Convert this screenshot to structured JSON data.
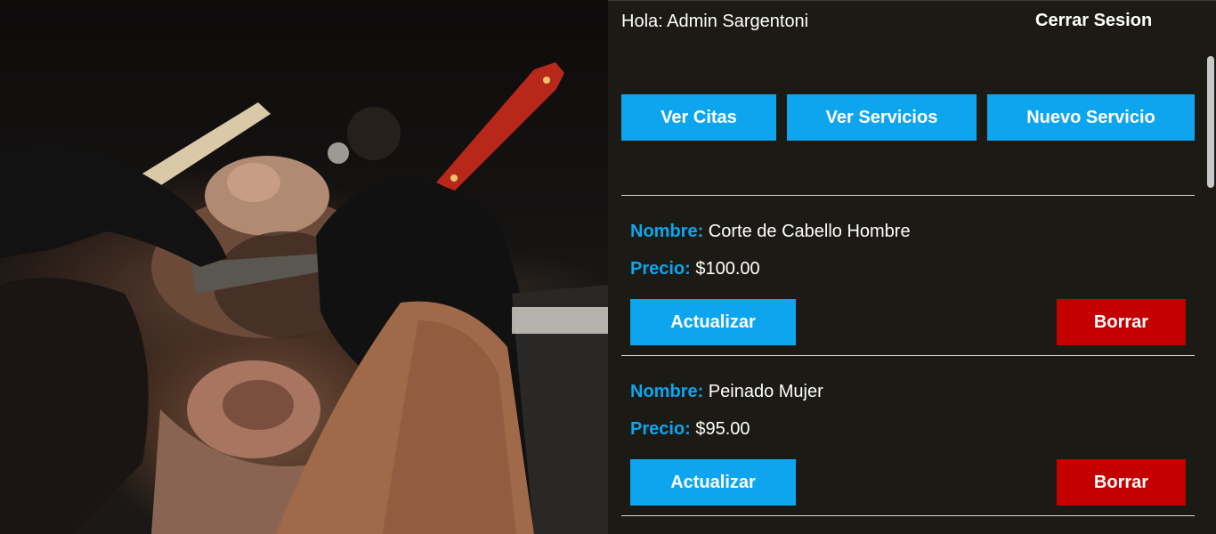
{
  "header": {
    "greeting": "Hola: Admin Sargentoni",
    "logout_label": "Cerrar Sesion"
  },
  "nav": {
    "ver_citas": "Ver Citas",
    "ver_servicios": "Ver Servicios",
    "nuevo_servicio": "Nuevo Servicio"
  },
  "labels": {
    "name": "Nombre:",
    "price": "Precio:",
    "update": "Actualizar",
    "delete": "Borrar"
  },
  "services": [
    {
      "name": "Corte de Cabello Hombre",
      "price": "$100.00"
    },
    {
      "name": "Peinado Mujer",
      "price": "$95.00"
    }
  ],
  "colors": {
    "accent": "#0da6ee",
    "danger": "#c40000",
    "background": "#1c1a15"
  }
}
